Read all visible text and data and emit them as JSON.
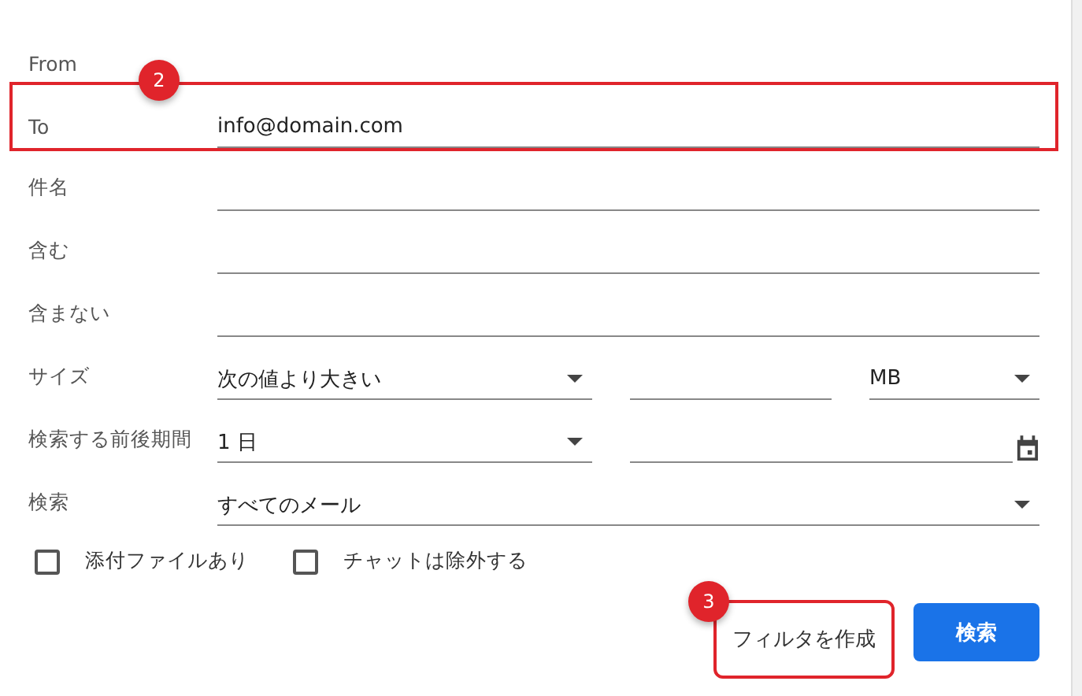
{
  "rows": [
    {
      "kind": "plain",
      "label": "From",
      "highlight": false
    },
    {
      "kind": "text",
      "label": "To",
      "value": "info@domain.com",
      "highlight": true,
      "marker": "2"
    },
    {
      "kind": "text",
      "label": "件名",
      "highlight": false
    },
    {
      "kind": "text",
      "label": "含む",
      "highlight": false
    },
    {
      "kind": "text",
      "label": "含まない",
      "highlight": false
    },
    {
      "kind": "size",
      "label": "サイズ",
      "value": "次の値より大きい",
      "unit": "MB",
      "highlight": false
    },
    {
      "kind": "date",
      "label": "検索する前後期間",
      "value": "1 日",
      "highlight": false
    },
    {
      "kind": "select",
      "label": "検索",
      "value": "すべてのメール",
      "highlight": false
    }
  ],
  "checkboxes": [
    {
      "label": "添付ファイルあり",
      "checked": false
    },
    {
      "label": "チャットは除外する",
      "checked": false
    }
  ],
  "buttons": [
    {
      "kind": "text",
      "label": "フィルタを作成",
      "highlight": true,
      "marker": "3"
    },
    {
      "kind": "primary",
      "label": "検索",
      "highlight": false
    }
  ]
}
